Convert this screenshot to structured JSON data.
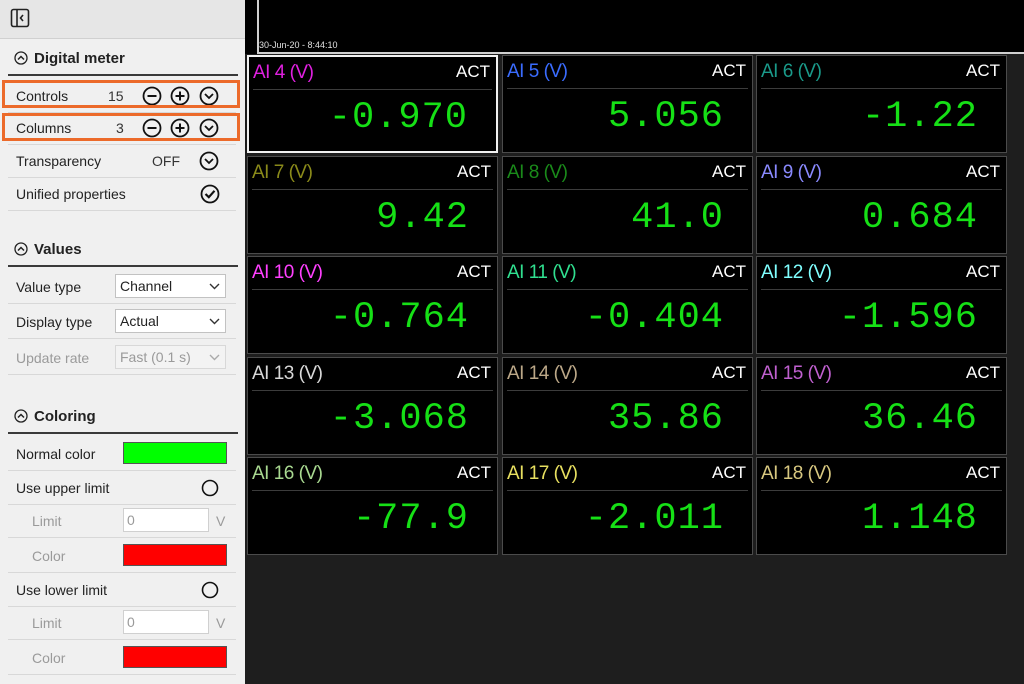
{
  "sections": {
    "digital_meter": "Digital meter",
    "values": "Values",
    "coloring": "Coloring"
  },
  "digital_meter": {
    "controls_label": "Controls",
    "controls_value": "15",
    "columns_label": "Columns",
    "columns_value": "3",
    "transparency_label": "Transparency",
    "transparency_value": "OFF",
    "unified_label": "Unified properties"
  },
  "values": {
    "value_type_label": "Value type",
    "value_type": "Channel",
    "display_type_label": "Display type",
    "display_type": "Actual",
    "update_rate_label": "Update rate",
    "update_rate": "Fast (0.1 s)"
  },
  "coloring": {
    "normal_color_label": "Normal color",
    "normal_color": "#00ff00",
    "upper_label": "Use upper limit",
    "upper_limit_label": "Limit",
    "upper_limit_value": "0",
    "upper_unit": "V",
    "upper_color_label": "Color",
    "upper_color": "#ff0000",
    "lower_label": "Use lower limit",
    "lower_limit_label": "Limit",
    "lower_limit_value": "0",
    "lower_unit": "V",
    "lower_color_label": "Color",
    "lower_color": "#ff0000"
  },
  "timestamp": "30-Jun-20 - 8:44:10",
  "highlight_color": "#ec6a2a",
  "value_color": "#16e016",
  "meters": [
    {
      "name": "AI 4 (V)",
      "status": "ACT",
      "value": "-0.970",
      "color": "#e020e0",
      "selected": true
    },
    {
      "name": "AI 5 (V)",
      "status": "ACT",
      "value": "5.056",
      "color": "#3a6cff"
    },
    {
      "name": "AI 6 (V)",
      "status": "ACT",
      "value": "-1.22",
      "color": "#1a9a8a"
    },
    {
      "name": "AI 7 (V)",
      "status": "ACT",
      "value": "9.42",
      "color": "#8a8a1a"
    },
    {
      "name": "AI 8 (V)",
      "status": "ACT",
      "value": "41.0",
      "color": "#1a8a1a"
    },
    {
      "name": "AI 9 (V)",
      "status": "ACT",
      "value": "0.684",
      "color": "#8a8aff"
    },
    {
      "name": "AI 10 (V)",
      "status": "ACT",
      "value": "-0.764",
      "color": "#ff40ff"
    },
    {
      "name": "AI 11 (V)",
      "status": "ACT",
      "value": "-0.404",
      "color": "#30e090"
    },
    {
      "name": "AI 12 (V)",
      "status": "ACT",
      "value": "-1.596",
      "color": "#80ffff"
    },
    {
      "name": "AI 13 (V)",
      "status": "ACT",
      "value": "-3.068",
      "color": "#d8d8d8"
    },
    {
      "name": "AI 14 (V)",
      "status": "ACT",
      "value": "35.86",
      "color": "#bca888"
    },
    {
      "name": "AI 15 (V)",
      "status": "ACT",
      "value": "36.46",
      "color": "#c060d0"
    },
    {
      "name": "AI 16 (V)",
      "status": "ACT",
      "value": "-77.9",
      "color": "#a8d890"
    },
    {
      "name": "AI 17 (V)",
      "status": "ACT",
      "value": "-2.011",
      "color": "#e8e060"
    },
    {
      "name": "AI 18 (V)",
      "status": "ACT",
      "value": "1.148",
      "color": "#d8c880"
    }
  ]
}
